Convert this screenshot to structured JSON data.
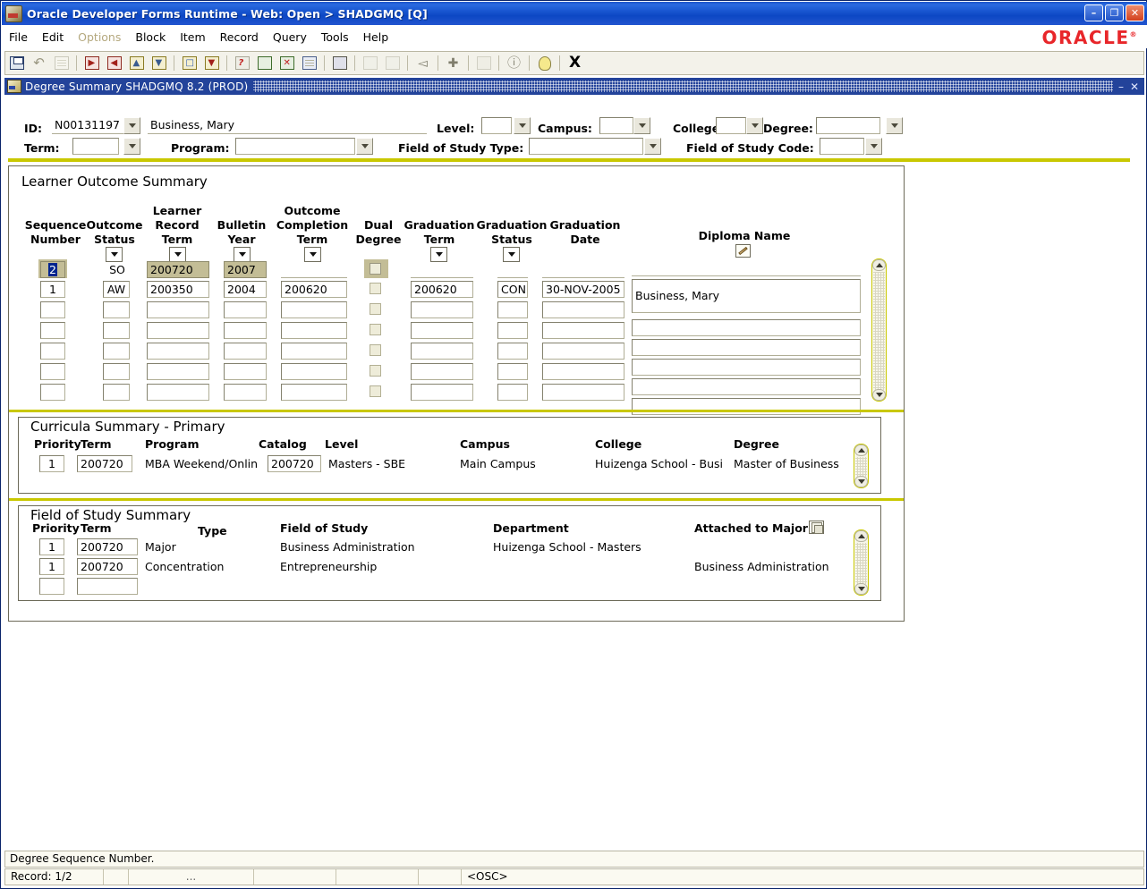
{
  "window": {
    "title": "Oracle Developer Forms Runtime - Web:  Open > SHADGMQ [Q]",
    "minimize": "–",
    "restore": "❐",
    "close": "✕",
    "brand": "ORACLE"
  },
  "menu": {
    "items": [
      {
        "label": "File",
        "disabled": false
      },
      {
        "label": "Edit",
        "disabled": false
      },
      {
        "label": "Options",
        "disabled": true
      },
      {
        "label": "Block",
        "disabled": false
      },
      {
        "label": "Item",
        "disabled": false
      },
      {
        "label": "Record",
        "disabled": false
      },
      {
        "label": "Query",
        "disabled": false
      },
      {
        "label": "Tools",
        "disabled": false
      },
      {
        "label": "Help",
        "disabled": false
      }
    ]
  },
  "toolbar": {
    "icons": [
      "save-icon",
      "rollback-icon",
      "select-icon",
      "sep",
      "insert-record-icon",
      "remove-record-icon",
      "previous-block-icon",
      "next-block-icon",
      "sep",
      "enter-query-icon",
      "execute-query-icon",
      "sep",
      "cancel-query-icon",
      "calculator-icon",
      "exit-icon",
      "print-screen-icon",
      "sep",
      "print-icon",
      "sep",
      "search-icon",
      "add-icon",
      "sep",
      "previous-item-icon",
      "sep",
      "list-of-values-icon",
      "sep",
      "edit-icon",
      "sep",
      "help-icon",
      "sep",
      "show-keys-icon",
      "sep"
    ],
    "exit_label": "X"
  },
  "form": {
    "title": "Degree Summary  SHADGMQ  8.2  (PROD)",
    "minimize": "–",
    "close": "✕"
  },
  "header": {
    "id_label": "ID:",
    "id_value": "N00131197",
    "name_value": "Business, Mary",
    "level_label": "Level:",
    "level_value": "",
    "campus_label": "Campus:",
    "campus_value": "",
    "college_label": "College:",
    "college_value": "",
    "degree_label": "Degree:",
    "degree_value": "",
    "term_label": "Term:",
    "term_value": "",
    "program_label": "Program:",
    "program_value": "",
    "fos_type_label": "Field of Study Type:",
    "fos_type_value": "",
    "fos_code_label": "Field of Study Code:",
    "fos_code_value": ""
  },
  "learner_outcome": {
    "title": "Learner Outcome Summary",
    "columns": [
      {
        "line1": "Sequence",
        "line2": "Number"
      },
      {
        "line1": "Outcome",
        "line2": "Status"
      },
      {
        "line1": "Learner",
        "line2": "Record",
        "line3": "Term"
      },
      {
        "line1": "Bulletin",
        "line2": "Year"
      },
      {
        "line1": "Outcome",
        "line2": "Completion",
        "line3": "Term"
      },
      {
        "line1": "Dual",
        "line2": "Degree"
      },
      {
        "line1": "Graduation",
        "line2": "Term"
      },
      {
        "line1": "Graduation",
        "line2": "Status"
      },
      {
        "line1": "Graduation",
        "line2": "Date"
      },
      {
        "line1": "Diploma Name"
      }
    ],
    "rows": [
      {
        "sequence": "2",
        "status": "SO",
        "record_term": "200720",
        "bulletin_year": "2007",
        "completion_term": "",
        "dual_degree": false,
        "graduation_term": "",
        "graduation_status": "",
        "graduation_date": "",
        "diploma_name": "",
        "selected": true
      },
      {
        "sequence": "1",
        "status": "AW",
        "record_term": "200350",
        "bulletin_year": "2004",
        "completion_term": "200620",
        "dual_degree": false,
        "graduation_term": "200620",
        "graduation_status": "CON",
        "graduation_date": "30-NOV-2005",
        "diploma_name": "Business, Mary",
        "selected": false
      },
      {
        "sequence": "",
        "status": "",
        "record_term": "",
        "bulletin_year": "",
        "completion_term": "",
        "dual_degree": false,
        "graduation_term": "",
        "graduation_status": "",
        "graduation_date": "",
        "diploma_name": "",
        "selected": false
      },
      {
        "sequence": "",
        "status": "",
        "record_term": "",
        "bulletin_year": "",
        "completion_term": "",
        "dual_degree": false,
        "graduation_term": "",
        "graduation_status": "",
        "graduation_date": "",
        "diploma_name": "",
        "selected": false
      },
      {
        "sequence": "",
        "status": "",
        "record_term": "",
        "bulletin_year": "",
        "completion_term": "",
        "dual_degree": false,
        "graduation_term": "",
        "graduation_status": "",
        "graduation_date": "",
        "diploma_name": "",
        "selected": false
      },
      {
        "sequence": "",
        "status": "",
        "record_term": "",
        "bulletin_year": "",
        "completion_term": "",
        "dual_degree": false,
        "graduation_term": "",
        "graduation_status": "",
        "graduation_date": "",
        "diploma_name": "",
        "selected": false
      },
      {
        "sequence": "",
        "status": "",
        "record_term": "",
        "bulletin_year": "",
        "completion_term": "",
        "dual_degree": false,
        "graduation_term": "",
        "graduation_status": "",
        "graduation_date": "",
        "diploma_name": "",
        "selected": false
      }
    ]
  },
  "curricula": {
    "title": "Curricula Summary - Primary",
    "columns": [
      "Priority",
      "Term",
      "Program",
      "Catalog",
      "Level",
      "Campus",
      "College",
      "Degree"
    ],
    "rows": [
      {
        "priority": "1",
        "term": "200720",
        "program": "MBA Weekend/Onlin",
        "catalog": "200720",
        "level": "Masters - SBE",
        "campus": "Main Campus",
        "college": "Huizenga School - Busi",
        "degree": "Master of Business"
      }
    ]
  },
  "field_of_study": {
    "title": "Field of Study Summary",
    "columns": [
      "Priority",
      "Term",
      "Type",
      "Field of Study",
      "Department",
      "Attached to Major"
    ],
    "rows": [
      {
        "priority": "1",
        "term": "200720",
        "type": "Major",
        "field_of_study": "Business Administration",
        "department": "Huizenga School - Masters",
        "attached_to_major": ""
      },
      {
        "priority": "1",
        "term": "200720",
        "type": "Concentration",
        "field_of_study": "Entrepreneurship",
        "department": "",
        "attached_to_major": "Business Administration"
      },
      {
        "priority": "",
        "term": "",
        "type": "",
        "field_of_study": "",
        "department": "",
        "attached_to_major": ""
      }
    ]
  },
  "status": {
    "message": "Degree Sequence Number.",
    "record": "Record: 1/2",
    "cell2": "",
    "cell3": "",
    "cell4": "...",
    "cell5": "",
    "cell6": "",
    "cell7": "",
    "osc": "<OSC>"
  },
  "colors": {
    "titlebar": "#1b52c8",
    "accent_yellow": "#c9c800",
    "khaki_field": "#c3bd96",
    "oracle_red": "#e8262a",
    "form_title": "#23439a"
  }
}
